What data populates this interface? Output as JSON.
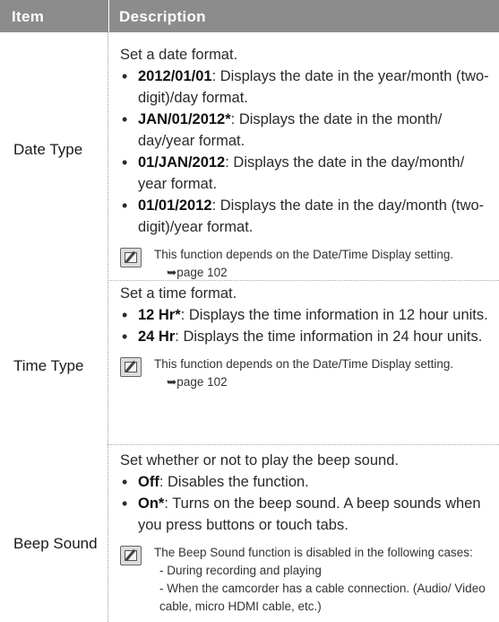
{
  "header": {
    "item_label": "Item",
    "description_label": "Description"
  },
  "rows": [
    {
      "item": "Date Type",
      "intro": "Set a date format.",
      "bullets": [
        {
          "term": "2012/01/01",
          "text": ": Displays the date in the year/month (two-digit)/day format."
        },
        {
          "term": "JAN/01/2012*",
          "text": ": Displays the date in the month/ day/year format."
        },
        {
          "term": "01/JAN/2012",
          "text": ": Displays the date in the day/month/ year format."
        },
        {
          "term": "01/01/2012",
          "text": ": Displays the date in the day/month (two-digit)/year format."
        }
      ],
      "note": "This function depends on the Date/Time Display setting.",
      "note_ref": "➥page 102"
    },
    {
      "item": "Time Type",
      "intro": "Set a time format.",
      "bullets": [
        {
          "term": "12 Hr*",
          "text": ": Displays the time information in 12 hour units."
        },
        {
          "term": "24 Hr",
          "text": ": Displays the time information in 24 hour units."
        }
      ],
      "note": "This function depends on the Date/Time Display setting.",
      "note_ref": "➥page 102"
    },
    {
      "item": "Beep Sound",
      "intro": "Set whether or not to play the beep sound.",
      "bullets": [
        {
          "term": "Off",
          "text": ": Disables the function."
        },
        {
          "term": "On*",
          "text": ": Turns on the beep sound. A beep sounds when you press buttons or touch tabs."
        }
      ],
      "note": "The Beep Sound function is disabled in the following cases:",
      "note_lines": [
        "- During recording and playing",
        "- When the camcorder has a cable connection. (Audio/ Video cable, micro HDMI cable, etc.)"
      ]
    }
  ]
}
